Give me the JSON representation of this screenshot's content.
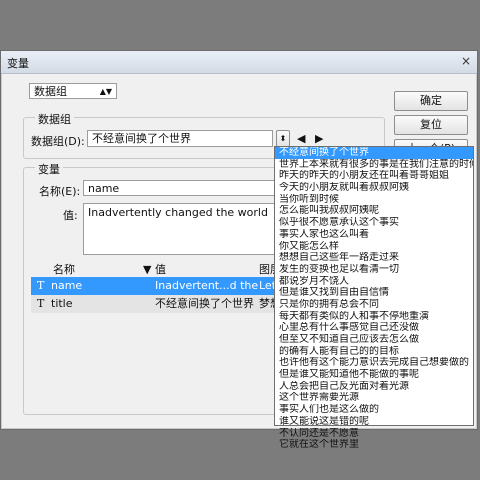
{
  "dialog": {
    "title": "变量",
    "close": "×",
    "top_select": "数据组"
  },
  "datasets": {
    "group_label": "数据组",
    "field_label": "数据组(D):",
    "value": "不经意间换了个世界"
  },
  "buttons": {
    "ok": "确定",
    "reset": "复位",
    "prev": "上一个(P)"
  },
  "variables": {
    "group_label": "变量",
    "name_label": "名称(E):",
    "name_value": "name",
    "value_label": "值:",
    "value_text": "Inadvertently changed the world",
    "table_headers": [
      "名称",
      "值",
      "图层"
    ],
    "rows": [
      {
        "icon": "T",
        "name": "name",
        "value": "Inadvertent...d the world",
        "layer": "Let t"
      },
      {
        "icon": "T",
        "name": "title",
        "value": "不经意间换了个世界",
        "layer": "梦想"
      }
    ]
  },
  "dropdown_options": [
    "不经意间换了个世界",
    "世界上本来就有很多的事是在我们注意的时候发生",
    "昨天的昨天的小朋友还在叫着哥哥姐姐",
    "今天的小朋友就叫着叔叔阿姨",
    "当你听到时候",
    "怎么能叫我叔叔阿姨呢",
    "似乎很不愿意承认这个事实",
    "事实人家也这么叫着",
    "你又能怎么样",
    "想想自己这些年一路走过来",
    "发生的变换也足以看清一切",
    "都说岁月不饶人",
    "但是谁又找到自由自信情",
    "只是你的拥有总会不同",
    "每天都有类似的人和事不停地重演",
    "心里总有什么事感觉自己还没做",
    "但至又不知道自己应该去怎么做",
    "的确有人能有自己的的目标",
    "也许他有这个能力意识去完成自己想要做的",
    "但是谁又能知道他不能做的事呢",
    "人总会把自己反光面对着光源",
    "这个世界需要光源",
    "事实人们也是这么做的",
    "谁又能说这是错的呢",
    "不认同还是不愿意",
    "它就在这个世界里"
  ]
}
